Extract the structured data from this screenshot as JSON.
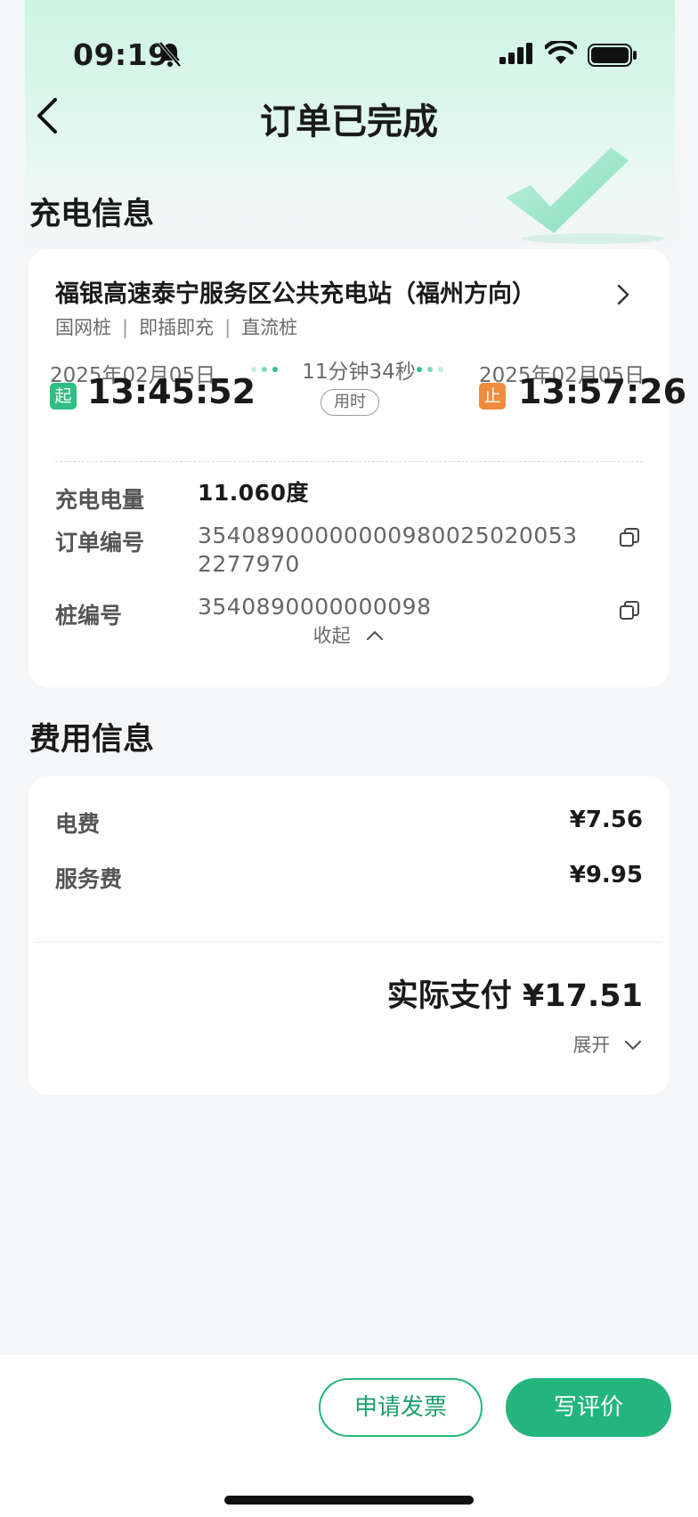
{
  "status_bar": {
    "time": "09:19"
  },
  "header": {
    "title": "订单已完成"
  },
  "charge_section": {
    "heading": "充电信息",
    "station_name": "福银高速泰宁服务区公共充电站（福州方向）",
    "tags": [
      "国网桩",
      "即插即充",
      "直流桩"
    ],
    "start": {
      "date": "2025年02月05日",
      "badge": "起",
      "time": "13:45:52"
    },
    "end": {
      "date": "2025年02月05日",
      "badge": "止",
      "time": "13:57:26"
    },
    "duration": "11分钟34秒",
    "duration_label": "用时",
    "details": [
      {
        "label": "充电电量",
        "value": "11.060度"
      },
      {
        "label": "订单编号",
        "value_line1": "35408900000000980025020053",
        "value_line2": "2277970"
      },
      {
        "label": "桩编号",
        "value": "3540890000000098"
      }
    ],
    "collapse_label": "收起"
  },
  "fee_section": {
    "heading": "费用信息",
    "items": [
      {
        "label": "电费",
        "amount": "¥7.56"
      },
      {
        "label": "服务费",
        "amount": "¥9.95"
      }
    ],
    "total": "实际支付 ¥17.51",
    "expand_label": "展开"
  },
  "actions": {
    "invoice": "申请发票",
    "review": "写评价"
  },
  "colors": {
    "accent": "#23b57c",
    "start_badge": "#2fbf82",
    "end_badge": "#f08a3c"
  }
}
